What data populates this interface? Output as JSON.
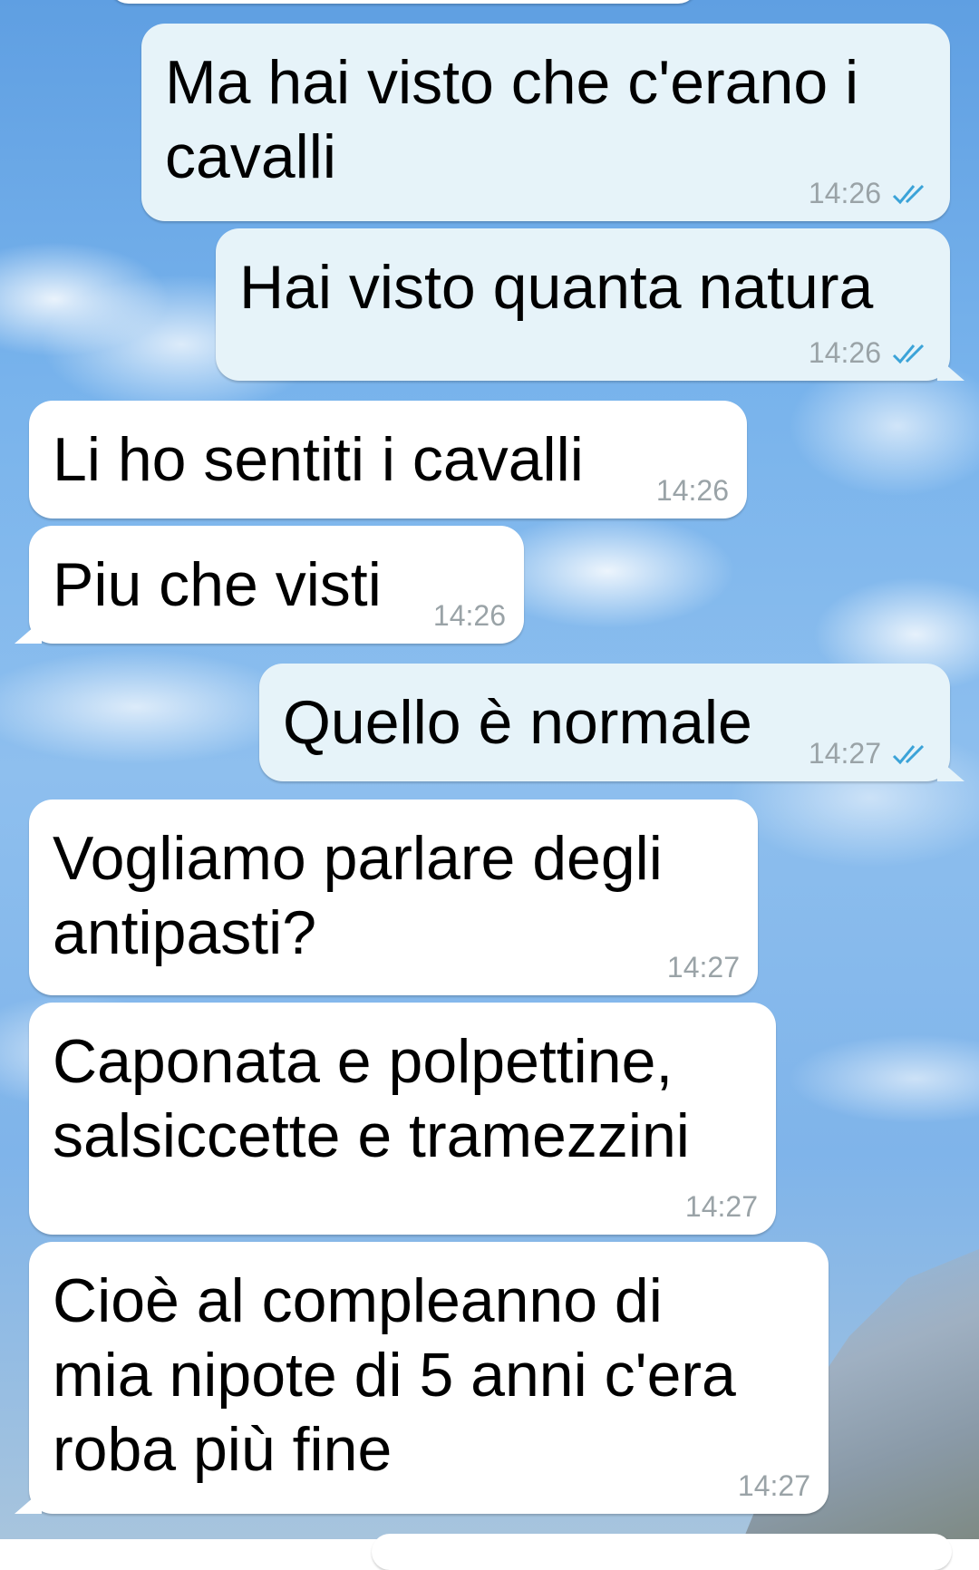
{
  "messages": [
    {
      "direction": "out",
      "text": "Ma hai visto che c'erano i\ncavalli",
      "time": "14:26",
      "status_icon": "double-check-icon"
    },
    {
      "direction": "out",
      "text": "Hai visto quanta natura",
      "time": "14:26",
      "status_icon": "double-check-icon"
    },
    {
      "direction": "in",
      "text": "Li ho sentiti i cavalli",
      "time": "14:26"
    },
    {
      "direction": "in",
      "text": "Piu che visti",
      "time": "14:26"
    },
    {
      "direction": "out",
      "text": "Quello è normale",
      "time": "14:27",
      "status_icon": "double-check-icon"
    },
    {
      "direction": "in",
      "text": "Vogliamo parlare degli\nantipasti?",
      "time": "14:27"
    },
    {
      "direction": "in",
      "text": "Caponata e polpettine,\nsalsiccette e tramezzini",
      "time": "14:27"
    },
    {
      "direction": "in",
      "text": "Cioè al compleanno di\nmia nipote di 5 anni c'era\nroba più fine",
      "time": "14:27"
    }
  ],
  "colors": {
    "outgoing_bubble": "#e6f3f9",
    "incoming_bubble": "#ffffff",
    "timestamp": "#9aa3a7",
    "read_ticks": "#3ba3d8"
  },
  "wallpaper": "sky-with-clouds-and-mountain"
}
